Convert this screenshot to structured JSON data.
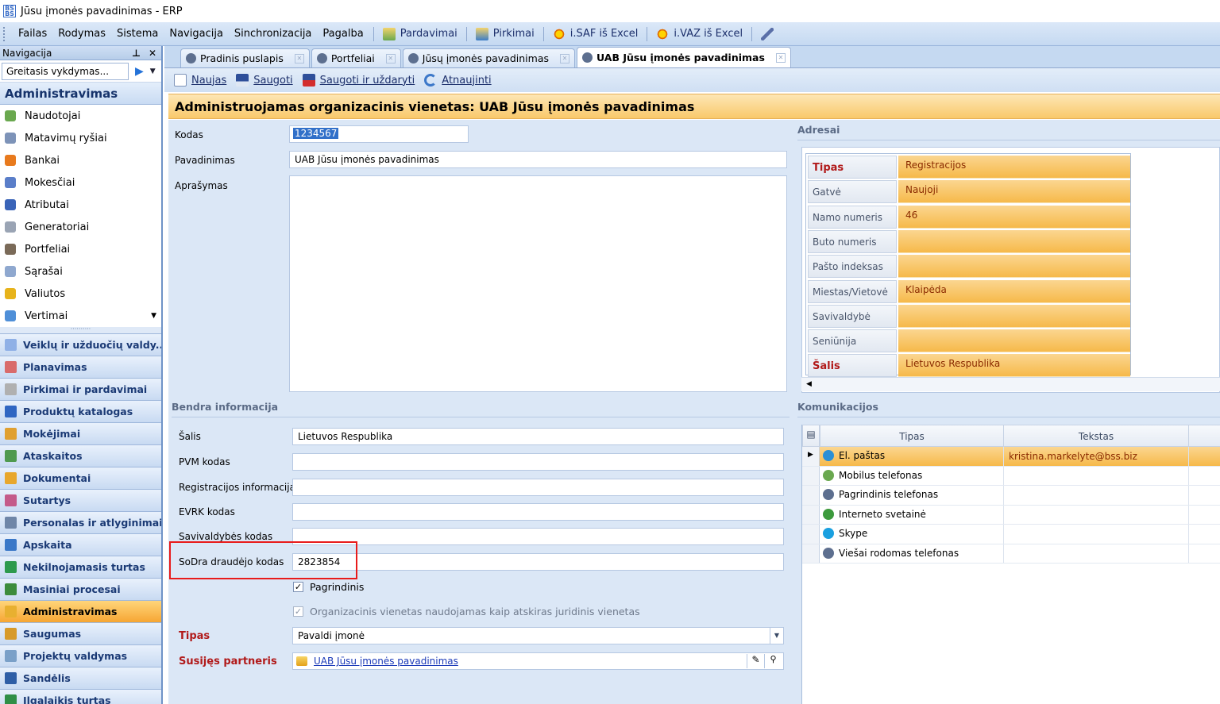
{
  "window": {
    "title": "Jūsu įmonės pavadinimas - ERP"
  },
  "menubar": {
    "items": [
      "Failas",
      "Rodymas",
      "Sistema",
      "Navigacija",
      "Sinchronizacija",
      "Pagalba"
    ],
    "buttons": [
      "Pardavimai",
      "Pirkimai",
      "i.SAF iš Excel",
      "i.VAZ iš Excel"
    ]
  },
  "nav": {
    "title": "Navigacija",
    "quick_placeholder": "Greitasis vykdymas...",
    "section": "Administravimas",
    "items": [
      "Naudotojai",
      "Matavimų ryšiai",
      "Bankai",
      "Mokesčiai",
      "Atributai",
      "Generatoriai",
      "Portfeliai",
      "Sąrašai",
      "Valiutos",
      "Vertimai"
    ],
    "groups": [
      "Veiklų ir užduočių valdy...",
      "Planavimas",
      "Pirkimai ir pardavimai",
      "Produktų katalogas",
      "Mokėjimai",
      "Ataskaitos",
      "Dokumentai",
      "Sutartys",
      "Personalas ir atlyginimai",
      "Apskaita",
      "Nekilnojamasis turtas",
      "Masiniai procesai",
      "Administravimas",
      "Saugumas",
      "Projektų valdymas",
      "Sandėlis",
      "Ilgalaikis turtas"
    ],
    "active_group": "Administravimas"
  },
  "tabs": [
    {
      "label": "Pradinis puslapis",
      "active": false
    },
    {
      "label": "Portfeliai",
      "active": false
    },
    {
      "label": "Jūsų įmonės pavadinimas",
      "active": false
    },
    {
      "label": "UAB Jūsu įmonės pavadinimas",
      "active": true
    }
  ],
  "doc_toolbar": {
    "new": "Naujas",
    "save": "Saugoti",
    "save_close": "Saugoti ir uždaryti",
    "refresh": "Atnaujinti"
  },
  "header": {
    "title": "Administruojamas organizacinis vienetas: UAB Jūsu įmonės pavadinimas"
  },
  "form": {
    "code_label": "Kodas",
    "code_value": "1234567",
    "name_label": "Pavadinimas",
    "name_value": "UAB Jūsu įmonės pavadinimas",
    "desc_label": "Aprašymas"
  },
  "general": {
    "title": "Bendra informacija",
    "country_label": "Šalis",
    "country_value": "Lietuvos Respublika",
    "vat_label": "PVM kodas",
    "reg_label": "Registracijos informacija",
    "evrk_label": "EVRK kodas",
    "municipality_code_label": "Savivaldybės kodas",
    "sodra_label": "SoDra draudėjo kodas",
    "sodra_value": "2823854",
    "main_check": "Pagrindinis",
    "legal_check": "Organizacinis vienetas naudojamas kaip atskiras juridinis vienetas",
    "type_label": "Tipas",
    "type_value": "Pavaldi įmonė",
    "partner_label": "Susijęs partneris",
    "partner_value": "UAB Jūsu įmonės pavadinimas"
  },
  "addresses": {
    "title": "Adresai",
    "rows": [
      {
        "key": "Tipas",
        "value": "Registracijos",
        "required": true
      },
      {
        "key": "Gatvė",
        "value": "Naujoji",
        "required": false
      },
      {
        "key": "Namo numeris",
        "value": "46",
        "required": false
      },
      {
        "key": "Buto numeris",
        "value": "",
        "required": false
      },
      {
        "key": "Pašto indeksas",
        "value": "",
        "required": false
      },
      {
        "key": "Miestas/Vietovė",
        "value": "Klaipėda",
        "required": false
      },
      {
        "key": "Savivaldybė",
        "value": "",
        "required": false
      },
      {
        "key": "Seniūnija",
        "value": "",
        "required": false
      },
      {
        "key": "Šalis",
        "value": "Lietuvos Respublika",
        "required": true
      }
    ]
  },
  "communications": {
    "title": "Komunikacijos",
    "col_type": "Tipas",
    "col_text": "Tekstas",
    "rows": [
      {
        "type": "El. paštas",
        "text": "kristina.markelyte@bss.biz",
        "selected": true
      },
      {
        "type": "Mobilus telefonas",
        "text": "",
        "selected": false
      },
      {
        "type": "Pagrindinis telefonas",
        "text": "",
        "selected": false
      },
      {
        "type": "Interneto svetainė",
        "text": "",
        "selected": false
      },
      {
        "type": "Skype",
        "text": "",
        "selected": false
      },
      {
        "type": "Viešai rodomas telefonas",
        "text": "",
        "selected": false
      }
    ]
  },
  "colors": {
    "accent_orange": "#f6b94a",
    "header_blue": "#c5d9f1",
    "highlight_red": "#e81b1b"
  }
}
